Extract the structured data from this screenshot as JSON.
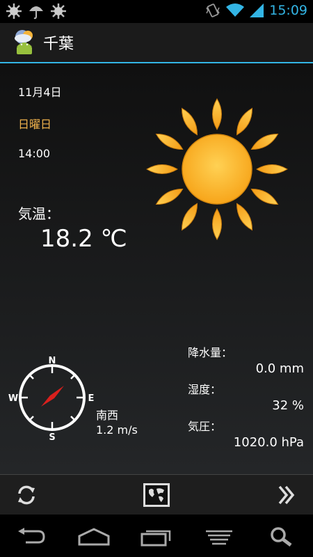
{
  "status_bar": {
    "time": "15:09",
    "left_icons": [
      "sun-notification-icon",
      "umbrella-notification-icon",
      "sun-notification-icon"
    ],
    "right_icons": [
      "vibrate-icon",
      "wifi-icon",
      "signal-icon"
    ]
  },
  "action_bar": {
    "title": "千葉",
    "app_icon": "weather-android-icon"
  },
  "weather": {
    "date": "11月4日",
    "weekday": "日曜日",
    "time": "14:00",
    "temperature_label": "気温：",
    "temperature_value": "18.2 ℃",
    "condition_icon": "sunny-icon",
    "wind_direction": "南西",
    "wind_speed": "1.2 m/s",
    "compass_letters": {
      "n": "N",
      "s": "S",
      "e": "E",
      "w": "W"
    },
    "precipitation_label": "降水量：",
    "precipitation_value": "0.0 mm",
    "humidity_label": "湿度：",
    "humidity_value": "32 %",
    "pressure_label": "気圧：",
    "pressure_value": "1020.0 hPa"
  },
  "toolbar": {
    "buttons": [
      "refresh-icon",
      "map-icon",
      "next-icon"
    ]
  },
  "nav_bar": {
    "buttons": [
      "back-icon",
      "home-icon",
      "recent-apps-icon",
      "menu-icon",
      "search-icon"
    ]
  },
  "colors": {
    "accent": "#33b5e5",
    "weekday": "#f0b24c",
    "sun": "#fbb12a",
    "wind_needle": "#d9201d"
  }
}
